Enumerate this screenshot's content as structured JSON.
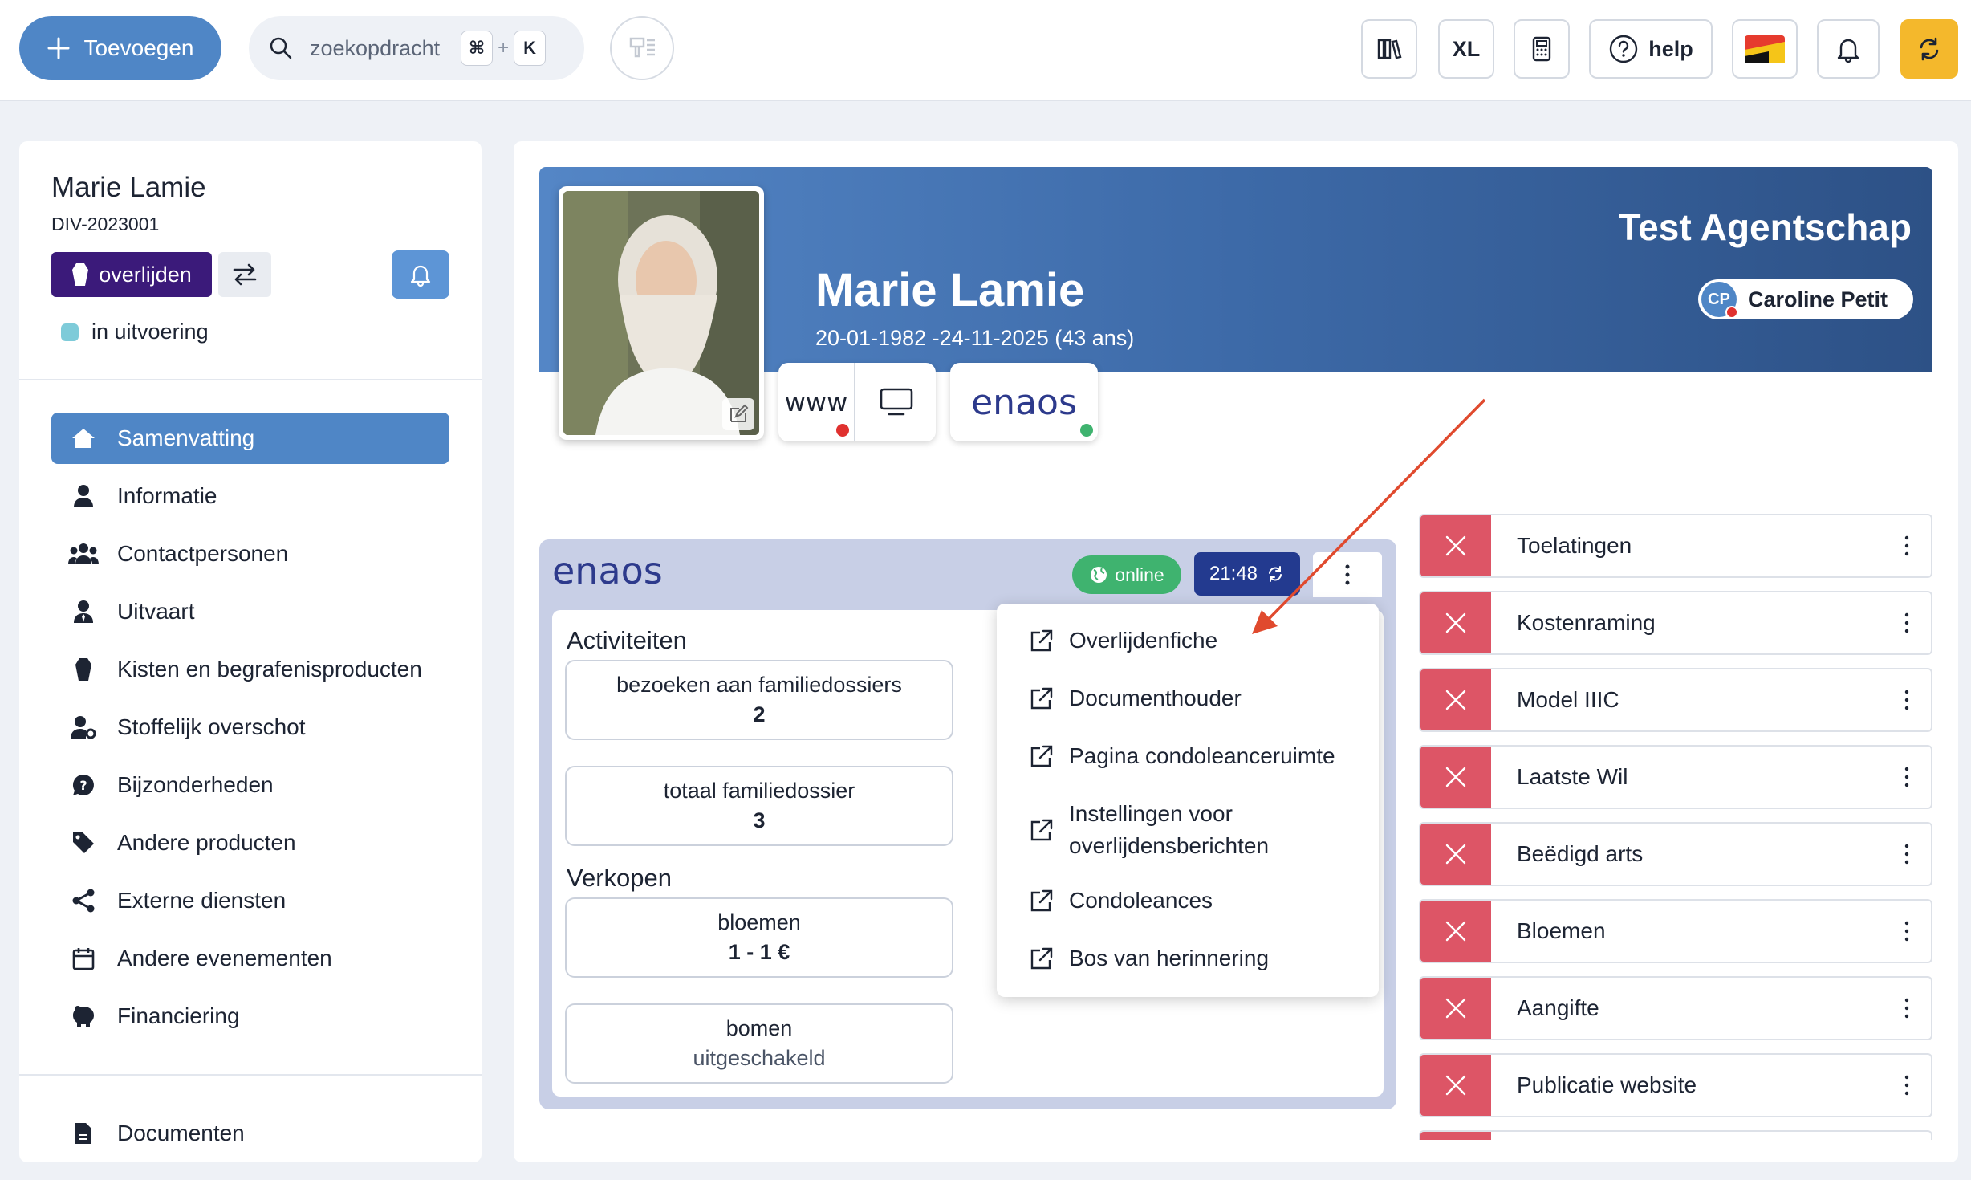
{
  "topbar": {
    "add_label": "Toevoegen",
    "search_placeholder": "zoekopdracht",
    "shortcut_cmd": "⌘",
    "shortcut_plus": "+",
    "shortcut_key": "K",
    "xl_label": "XL",
    "help_label": "help"
  },
  "sidebar": {
    "name": "Marie Lamie",
    "id": "DIV-2023001",
    "badge": "overlijden",
    "status": "in uitvoering",
    "nav": [
      {
        "label": "Samenvatting",
        "icon": "home-icon"
      },
      {
        "label": "Informatie",
        "icon": "person-icon"
      },
      {
        "label": "Contactpersonen",
        "icon": "people-icon"
      },
      {
        "label": "Uitvaart",
        "icon": "person-tie-icon"
      },
      {
        "label": "Kisten en begrafenisproducten",
        "icon": "coffin-icon"
      },
      {
        "label": "Stoffelijk overschot",
        "icon": "person-gear-icon"
      },
      {
        "label": "Bijzonderheden",
        "icon": "question-bubble-icon"
      },
      {
        "label": "Andere producten",
        "icon": "tag-icon"
      },
      {
        "label": "Externe diensten",
        "icon": "share-icon"
      },
      {
        "label": "Andere evenementen",
        "icon": "calendar-icon"
      },
      {
        "label": "Financiering",
        "icon": "piggy-bank-icon"
      }
    ],
    "documents": "Documenten"
  },
  "hero": {
    "name": "Marie Lamie",
    "dates": "20-01-1982 -24-11-2025 (43 ans)",
    "agency": "Test Agentschap",
    "agent_initials": "CP",
    "agent_name": "Caroline Petit",
    "www": "www",
    "enaos": "enaos"
  },
  "widget": {
    "logo": "enaos",
    "online": "online",
    "time": "21:48",
    "sections": {
      "activities": "Activiteiten",
      "sales": "Verkopen"
    },
    "stats": [
      {
        "label": "bezoeken aan familiedossiers",
        "value": "2"
      },
      {
        "label": "totaal familiedossier",
        "value": "3"
      },
      {
        "label": "bloemen",
        "value": "1 - 1 €"
      },
      {
        "label": "bomen",
        "value": "uitgeschakeld"
      }
    ]
  },
  "menu": [
    "Overlijdenfiche",
    "Documenthouder",
    "Pagina condoleanceruimte",
    "Instellingen voor overlijdensberichten",
    "Condoleances",
    "Bos van herinnering"
  ],
  "checklist": [
    "Toelatingen",
    "Kostenraming",
    "Model IIIC",
    "Laatste Wil",
    "Beëdigd arts",
    "Bloemen",
    "Aangifte",
    "Publicatie website"
  ],
  "colors": {
    "primary": "#4f86c6",
    "badge": "#3b1a7a",
    "online": "#3fb36f",
    "clock": "#233a8f",
    "danger": "#dd5566",
    "refresh": "#f4b82c",
    "arrow": "#e04a2e"
  }
}
